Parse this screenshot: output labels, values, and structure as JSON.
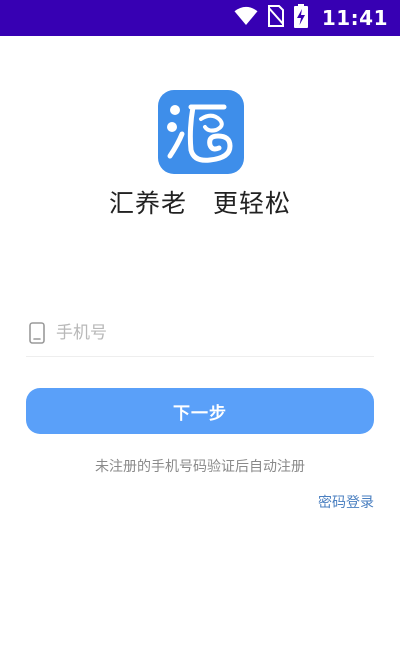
{
  "status_bar": {
    "time": "11:41",
    "bg_color": "#3700b3",
    "icons": [
      "wifi-icon",
      "no-sim-icon",
      "battery-charging-icon"
    ]
  },
  "app": {
    "logo": "app-logo",
    "logo_color": "#3e8eea",
    "slogan": "汇养老　更轻松"
  },
  "login": {
    "phone_icon": "phone-icon",
    "phone_placeholder": "手机号",
    "phone_value": "",
    "next_button_label": "下一步",
    "next_button_color": "#5aa0f9",
    "hint_text": "未注册的手机号码验证后自动注册",
    "password_login_label": "密码登录",
    "link_color": "#4a7fc0"
  }
}
